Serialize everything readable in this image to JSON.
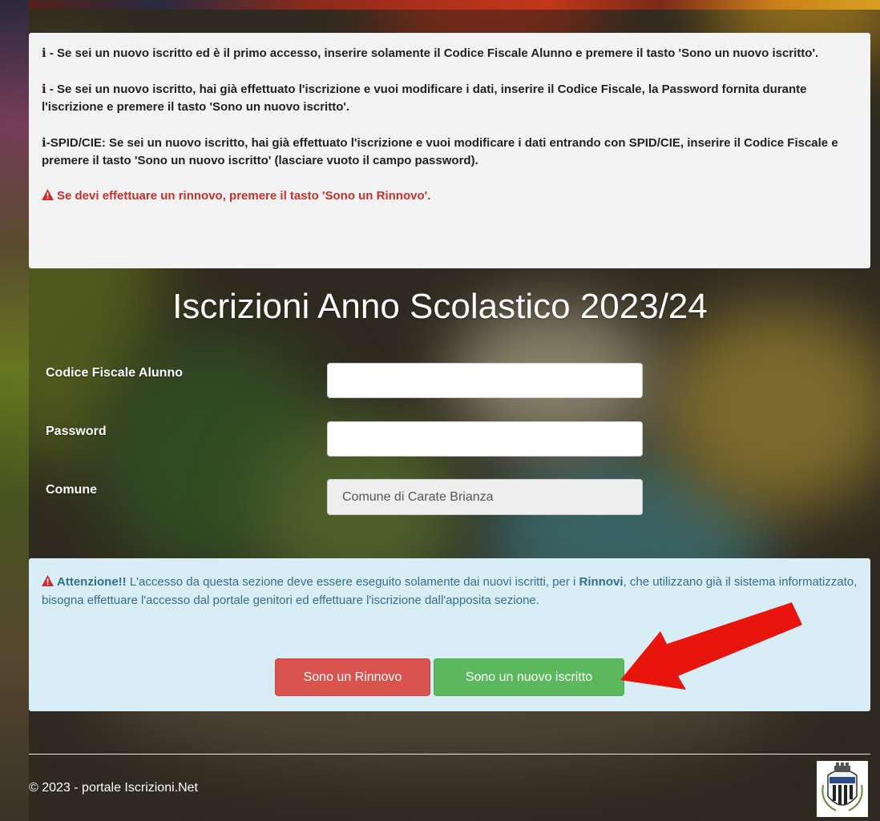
{
  "info": {
    "line1_prefix": "i",
    "line1": " - Se sei un nuovo iscritto ed è il primo accesso, inserire solamente il Codice Fiscale Alunno e premere il tasto 'Sono un nuovo iscritto'.",
    "line2_prefix": "i",
    "line2": " - Se sei un nuovo iscritto, hai già effettuato l'iscrizione e vuoi modificare i dati, inserire il Codice Fiscale, la Password fornita durante l'iscrizione e premere il tasto 'Sono un nuovo iscritto'.",
    "line3_prefix": "i",
    "line3": "-SPID/CIE: Se sei un nuovo iscritto, hai già effettuato l'iscrizione e vuoi modificare i dati entrando con SPID/CIE, inserire il Codice Fiscale e premere il tasto 'Sono un nuovo iscritto' (lasciare vuoto il campo password).",
    "warning": "Se devi effettuare un rinnovo, premere il tasto 'Sono un Rinnovo'."
  },
  "title": "Iscrizioni Anno Scolastico 2023/24",
  "form": {
    "codice_label": "Codice Fiscale Alunno",
    "codice_value": "",
    "password_label": "Password",
    "password_value": "",
    "comune_label": "Comune",
    "comune_value": "Comune di Carate Brianza"
  },
  "attention": {
    "heading": "Attenzione!!",
    "text1": " L'accesso da questa sezione deve essere eseguito solamente dai nuovi iscritti, per i ",
    "bold_word": "Rinnovi",
    "text2": ", che utilizzano già il sistema informatizzato, bisogna effettuare l'accesso dal portale genitori ed effettuare l'iscrizione dall'apposita sezione."
  },
  "buttons": {
    "rinnovo": "Sono un Rinnovo",
    "nuovo": "Sono un nuovo iscritto"
  },
  "footer": {
    "copyright": "© 2023 - portale Iscrizioni.Net"
  },
  "colors": {
    "danger": "#d9534f",
    "success": "#5cb85c",
    "info_bg": "#d9edf7",
    "info_text": "#31708f",
    "warning_text": "#c9302c",
    "arrow": "#e8150c"
  },
  "icons": {
    "info": "info-icon",
    "warning": "warning-triangle-icon",
    "arrow": "red-arrow-annotation",
    "crest": "municipal-crest-logo"
  }
}
